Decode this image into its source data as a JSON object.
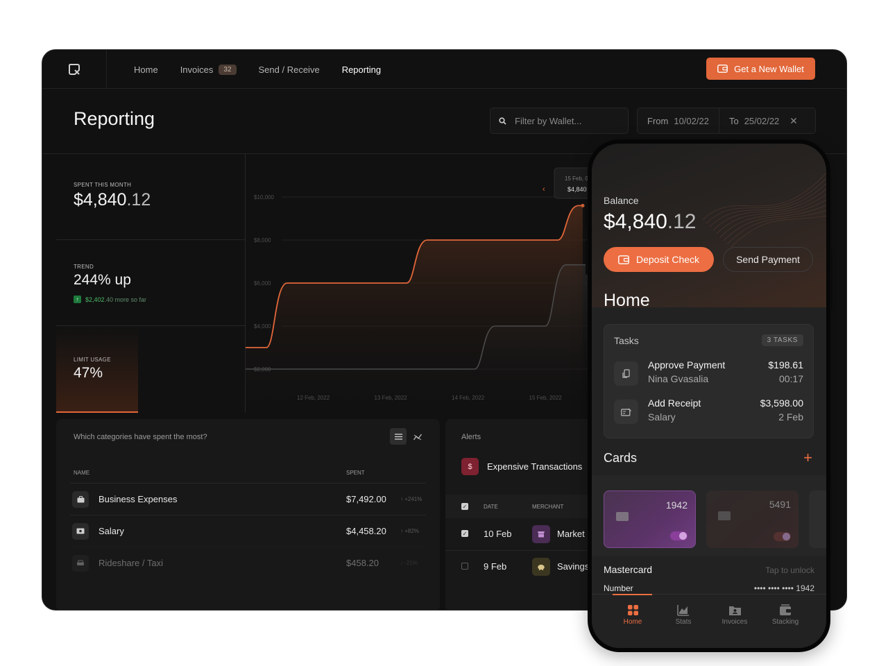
{
  "desktop": {
    "nav": {
      "links": [
        "Home",
        "Invoices",
        "Send / Receive",
        "Reporting"
      ],
      "invoices_badge": "32",
      "wallet_button": "Get a New Wallet"
    },
    "title": "Reporting",
    "filter_placeholder": "Filter by Wallet...",
    "date_range": {
      "from_label": "From",
      "from_value": "10/02/22",
      "to_label": "To",
      "to_value": "25/02/22"
    },
    "stats": {
      "spent_label": "SPENT THIS MONTH",
      "spent_int": "$4,840",
      "spent_dec": ".12",
      "trend_label": "TREND",
      "trend_value": "244% up",
      "trend_amount": "$2,402",
      "trend_amount_dec": ".40 more so far",
      "limit_label": "LIMIT USAGE",
      "limit_value": "47%",
      "limit_fraction": 0.47
    },
    "categories": {
      "question": "Which categories have spent the most?",
      "col_name": "NAME",
      "col_spent": "SPENT",
      "rows": [
        {
          "name": "Business Expenses",
          "amount": "$7,492.00",
          "change": "↑ +241%"
        },
        {
          "name": "Salary",
          "amount": "$4,458.20",
          "change": "↑ +82%"
        },
        {
          "name": "Rideshare / Taxi",
          "amount": "$458.20",
          "change": "↓ -21%"
        }
      ]
    },
    "alerts": {
      "title": "Alerts",
      "item": "Expensive Transactions",
      "col_date": "DATE",
      "col_merchant": "MERCHANT",
      "rows": [
        {
          "date": "10 Feb",
          "merchant": "Market",
          "checked": true
        },
        {
          "date": "9 Feb",
          "merchant": "Savings",
          "checked": false
        }
      ]
    },
    "tooltip": {
      "date": "15 Feb, 0",
      "value": "$4,840"
    }
  },
  "chart_data": {
    "type": "area",
    "x": [
      "11 Feb, 2022",
      "12 Feb, 2022",
      "13 Feb, 2022",
      "14 Feb, 2022",
      "15 Feb, 2022"
    ],
    "x_tick_labels": [
      "12 Feb, 2022",
      "13 Feb, 2022",
      "14 Feb, 2022",
      "15 Feb, 2022"
    ],
    "y_tick_labels": [
      "$10,000",
      "$8,000",
      "$6,000",
      "$4,000",
      "$2,000"
    ],
    "ylim": [
      2000,
      10000
    ],
    "series": [
      {
        "values": [
          3000,
          6000,
          8000,
          8000,
          9600
        ],
        "color": "#e2673a"
      },
      {
        "values": [
          2000,
          2000,
          2000,
          4000,
          6850
        ],
        "color": "#4a4a4a"
      }
    ],
    "grid": true
  },
  "phone": {
    "balance_label": "Balance",
    "balance_int": "$4,840",
    "balance_dec": ".12",
    "deposit_button": "Deposit Check",
    "send_button": "Send Payment",
    "home_title": "Home",
    "tasks": {
      "title": "Tasks",
      "badge": "3 TASKS",
      "items": [
        {
          "title": "Approve Payment",
          "subtitle": "Nina Gvasalia",
          "amount": "$198.61",
          "detail": "00:17"
        },
        {
          "title": "Add Receipt",
          "subtitle": "Salary",
          "amount": "$3,598.00",
          "detail": "2 Feb"
        }
      ]
    },
    "cards_title": "Cards",
    "cards": [
      "1942",
      "5491"
    ],
    "card_name": "Mastercard",
    "card_hint": "Tap to unlock",
    "number_label": "Number",
    "number_value": "•••• •••• •••• 1942",
    "tabs": [
      "Home",
      "Stats",
      "Invoices",
      "Stacking"
    ]
  },
  "colors": {
    "accent": "#e2673a",
    "positive": "#4dbb6a"
  }
}
